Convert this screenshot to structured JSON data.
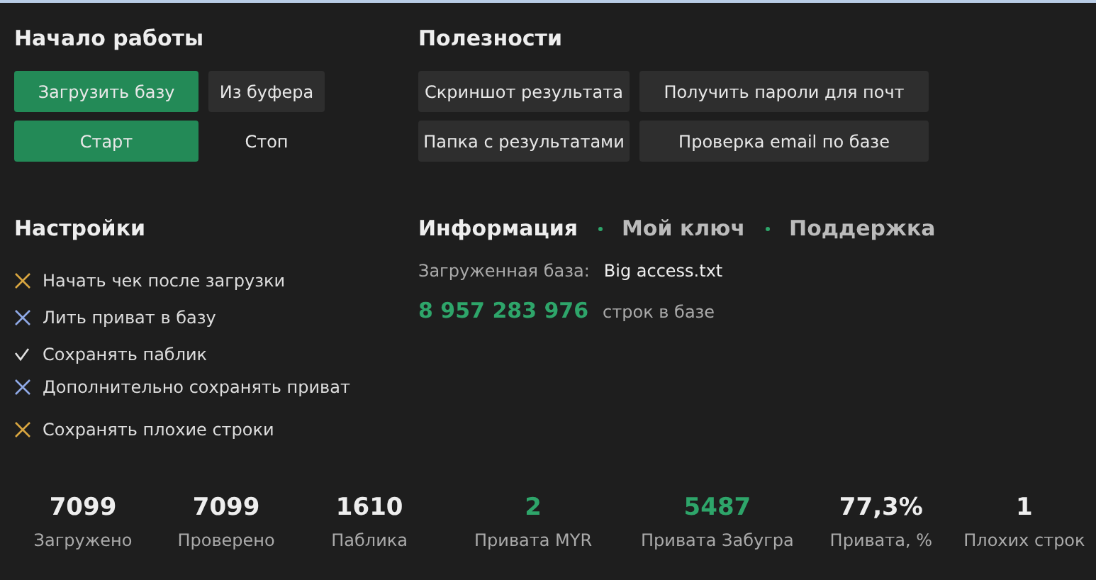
{
  "start": {
    "title": "Начало работы",
    "buttons": [
      {
        "label": "Загрузить базу",
        "kind": "primary"
      },
      {
        "label": "Из буфера",
        "kind": "secondary"
      },
      {
        "label": "Старт",
        "kind": "primary"
      },
      {
        "label": "Стоп",
        "kind": "plain"
      }
    ]
  },
  "utilities": {
    "title": "Полезности",
    "buttons": [
      {
        "label": "Скриншот результата",
        "kind": "secondary"
      },
      {
        "label": "Получить пароли для почт",
        "kind": "secondary"
      },
      {
        "label": "Папка с результатами",
        "kind": "secondary"
      },
      {
        "label": "Проверка email по базе",
        "kind": "secondary"
      }
    ]
  },
  "settings": {
    "title": "Настройки",
    "options": [
      {
        "label": "Начать чек после загрузки",
        "kind": "cross",
        "color": "#d9a640"
      },
      {
        "label": "Лить приват в базу",
        "kind": "cross",
        "color": "#8fa9e6"
      },
      {
        "label": "Сохранять паблик",
        "kind": "check",
        "color": "#e0e0e0"
      },
      {
        "label": "Дополнительно сохранять приват",
        "kind": "cross",
        "color": "#8fa9e6"
      },
      {
        "label": "Сохранять плохие строки",
        "kind": "cross",
        "color": "#d9a640"
      }
    ]
  },
  "info": {
    "tabs": [
      {
        "label": "Информация",
        "selected": true
      },
      {
        "label": "Мой ключ",
        "selected": false
      },
      {
        "label": "Поддержка",
        "selected": false
      }
    ],
    "loaded_label": "Загруженная база:",
    "loaded_value": "Big access.txt",
    "count": "8 957 283 976",
    "count_label": "строк в базе"
  },
  "stats": [
    {
      "value": "7099",
      "label": "Загружено",
      "highlight": false
    },
    {
      "value": "7099",
      "label": "Проверено",
      "highlight": false
    },
    {
      "value": "1610",
      "label": "Паблика",
      "highlight": false
    },
    {
      "value": "2",
      "label": "Привата MYR",
      "highlight": true
    },
    {
      "value": "5487",
      "label": "Привата Забугра",
      "highlight": true
    },
    {
      "value": "77,3%",
      "label": "Привата, %",
      "highlight": false
    },
    {
      "value": "1",
      "label": "Плохих строк",
      "highlight": false
    }
  ]
}
